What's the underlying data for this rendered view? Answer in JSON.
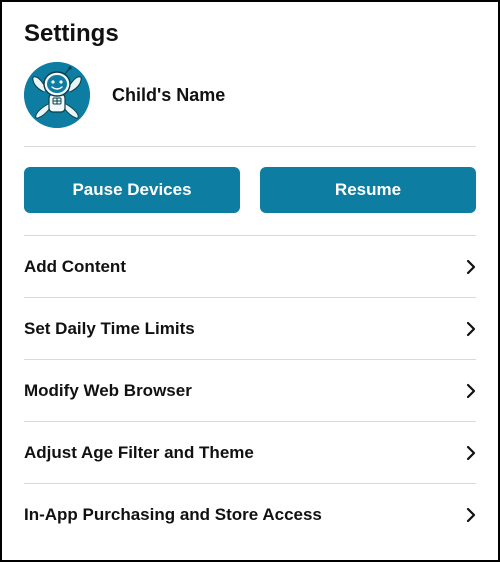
{
  "title": "Settings",
  "profile": {
    "name": "Child's Name"
  },
  "buttons": {
    "pause": "Pause Devices",
    "resume": "Resume"
  },
  "items": [
    {
      "label": "Add Content"
    },
    {
      "label": "Set Daily Time Limits"
    },
    {
      "label": "Modify Web Browser"
    },
    {
      "label": "Adjust Age Filter and Theme"
    },
    {
      "label": "In-App Purchasing and Store Access"
    }
  ],
  "colors": {
    "accent": "#0d7ea2"
  }
}
